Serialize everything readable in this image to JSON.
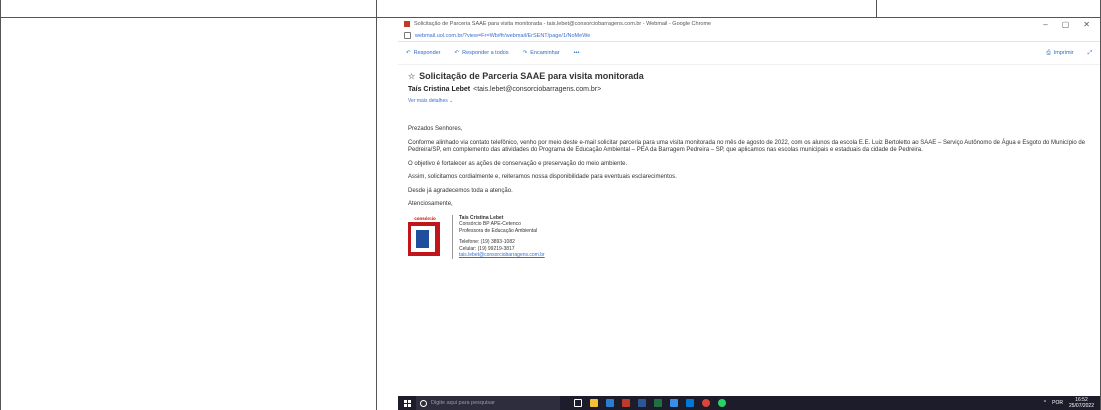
{
  "browser": {
    "title": "Solicitação de Parceria SAAE para visita monitorada - tais.lebet@consorciobarragens.com.br - Webmail - Google Chrome",
    "url": "webmail.uol.com.br/?view=Fr=Wb#fr/webmail/ErSENT/page/1/NoMeWe",
    "controls": [
      "–",
      "▢",
      "✕"
    ]
  },
  "toolbar": {
    "reply": "Responder",
    "reply_all": "Responder a todos",
    "forward": "Encaminhar",
    "more": "•••",
    "print": "Imprimir"
  },
  "email": {
    "subject": "Solicitação de Parceria SAAE para visita monitorada",
    "sender_name": "Taís Cristina Lebet",
    "sender_email": "<tais.lebet@consorciobarragens.com.br>",
    "details": "Ver mais detalhes",
    "greeting": "Prezados Senhores,",
    "p1": "Conforme alinhado via contato telefônico, venho por meio deste e-mail solicitar parceria para uma visita monitorada no mês de agosto de 2022, com os alunos da escola E.E. Luiz Bertoletto ao SAAE – Serviço Autônomo de Água e Esgoto do Município de Pedreira/SP, em complemento das atividades do Programa de Educação Ambiental – PEA da Barragem Pedreira – SP, que aplicamos nas escolas municipais e estaduais da cidade de Pedreira.",
    "p2": "O objetivo é fortalecer as ações de conservação e preservação do meio ambiente.",
    "p3": "Assim, solicitamos cordialmente e, reiteramos nossa disponibilidade para eventuais esclarecimentos.",
    "p4": "Desde já agradecemos toda a atenção.",
    "closing": "Atenciosamente,"
  },
  "signature": {
    "logo_text": "consórcio",
    "name": "Taís Cristina Lebet",
    "company": "Consórcio BP APE-Cetenco",
    "role": "Professora de Educação Ambiental",
    "phone": "Telefone: (19) 3893-1082",
    "mobile": "Celular: (19) 99219-3817",
    "email": "tais.lebet@consorciobarragens.com.br"
  },
  "taskbar": {
    "search_placeholder": "Digite aqui para pesquisar",
    "time": "16:52",
    "date": "25/07/2022",
    "lang": "POR"
  },
  "colors": {
    "taskbar": "#1c1c2b",
    "accent": "#2b6cc4",
    "logo_red": "#c0161b",
    "logo_blue": "#1f4e9c"
  }
}
